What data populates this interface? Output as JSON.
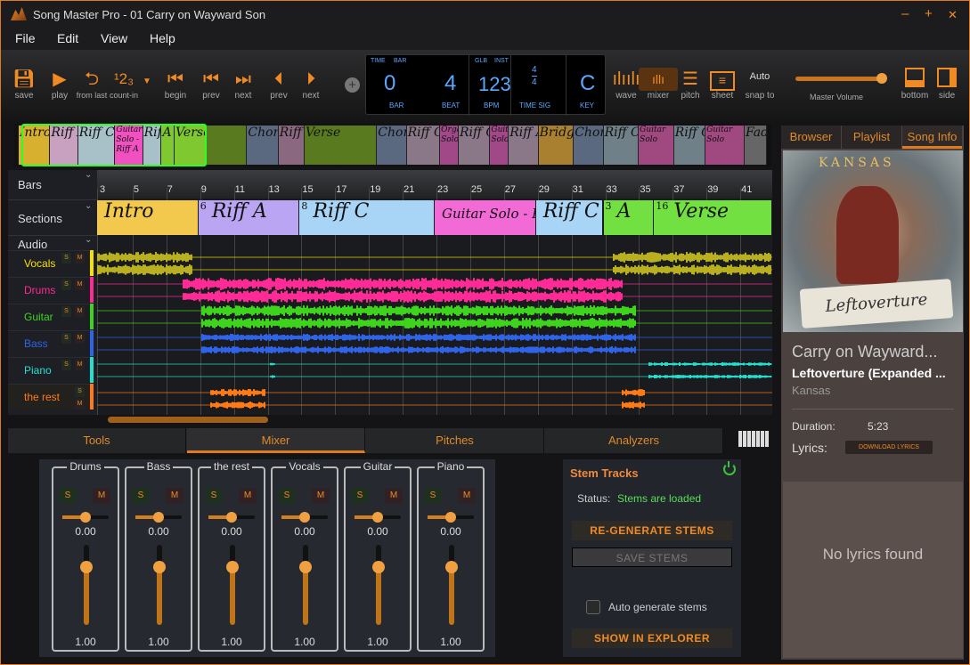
{
  "window": {
    "title": "Song Master Pro - 01 Carry on Wayward Son",
    "minimize": "–",
    "maximize": "+",
    "close": "✕"
  },
  "menu": [
    "File",
    "Edit",
    "View",
    "Help"
  ],
  "toolbar": {
    "save": "save",
    "play": "play",
    "from_last": "from last",
    "count_in": "count-in",
    "begin": "begin",
    "prev1": "prev",
    "next1": "next",
    "prev2": "prev",
    "next2": "next",
    "wave": "wave",
    "mixer": "mixer",
    "pitch": "pitch",
    "sheet": "sheet",
    "snap_value": "Auto",
    "snap": "snap to",
    "master_volume": "Master Volume",
    "master_volume_level": 0.97,
    "bottom": "bottom",
    "side": "side"
  },
  "display": {
    "time_label": "TIME",
    "bar_label_top": "BAR",
    "bar": "0",
    "bar_label": "BAR",
    "beat": "4",
    "beat_label": "BEAT",
    "glb": "GLB",
    "inst": "INST",
    "bpm": "123",
    "bpm_label": "BPM",
    "ts_num": "4",
    "ts_den": "4",
    "ts_label": "TIME SIG",
    "key": "C",
    "key_label": "KEY"
  },
  "overview": [
    {
      "label": "Intro",
      "color": "#d8b030"
    },
    {
      "label": "Riff A",
      "color": "#c8a0c0"
    },
    {
      "label": "Riff C",
      "color": "#a8c0c8"
    },
    {
      "label": "Guitar Solo - Riff A",
      "color": "#f050c0"
    },
    {
      "label": "Riff C",
      "color": "#a8c0c8"
    },
    {
      "label": "A",
      "color": "#80c830"
    },
    {
      "label": "Verse",
      "color": "#80c830"
    },
    {
      "label": "",
      "color": "#5a7a20"
    },
    {
      "label": "Chorus",
      "color": "#5a6880"
    },
    {
      "label": "Riff A",
      "color": "#8a6880"
    },
    {
      "label": "Verse",
      "color": "#5a7a20"
    },
    {
      "label": "Chorus",
      "color": "#5a6880"
    },
    {
      "label": "Riff C",
      "color": "#8a7888"
    },
    {
      "label": "Organ Solo",
      "color": "#a04888"
    },
    {
      "label": "Riff C",
      "color": "#8a7888"
    },
    {
      "label": "Guitar Solo",
      "color": "#a04888"
    },
    {
      "label": "Riff A",
      "color": "#8a7888"
    },
    {
      "label": "Bridge",
      "color": "#a88030"
    },
    {
      "label": "Chorus",
      "color": "#5a6880"
    },
    {
      "label": "Riff C",
      "color": "#708088"
    },
    {
      "label": "Guitar Solo",
      "color": "#a04880"
    },
    {
      "label": "Riff C",
      "color": "#708088"
    },
    {
      "label": "Guitar Solo",
      "color": "#a04880"
    },
    {
      "label": "Fade out",
      "color": "#666"
    }
  ],
  "lanes": {
    "bars": "Bars",
    "sections": "Sections",
    "audio": "Audio"
  },
  "bar_numbers": [
    "3",
    "5",
    "7",
    "9",
    "11",
    "13",
    "15",
    "17",
    "19",
    "21",
    "23",
    "25",
    "27",
    "29",
    "31",
    "33",
    "35",
    "37",
    "39",
    "41"
  ],
  "sections": [
    {
      "num": "",
      "label": "Intro",
      "start": 3,
      "end": 9,
      "color": "#f2c94c"
    },
    {
      "num": "6",
      "label": "Riff A",
      "start": 9,
      "end": 15,
      "color": "#b9a5f2"
    },
    {
      "num": "8",
      "label": "Riff C",
      "start": 15,
      "end": 23,
      "color": "#a8d4f5"
    },
    {
      "num": "",
      "label": "Guitar Solo - Riff A",
      "start": 23,
      "end": 29,
      "color": "#f26ad6"
    },
    {
      "num": "",
      "label": "Riff C",
      "start": 29,
      "end": 33,
      "color": "#a8d4f5"
    },
    {
      "num": "3",
      "label": "A",
      "start": 33,
      "end": 36,
      "color": "#72e040"
    },
    {
      "num": "16",
      "label": "Verse",
      "start": 36,
      "end": 43,
      "color": "#72e040"
    }
  ],
  "tracks": [
    {
      "name": "Vocals",
      "color": "#f5e100",
      "solo": "S",
      "mute": "M"
    },
    {
      "name": "Drums",
      "color": "#ff2a95",
      "solo": "S",
      "mute": "M"
    },
    {
      "name": "Guitar",
      "color": "#3ed41e",
      "solo": "S",
      "mute": "M"
    },
    {
      "name": "Bass",
      "color": "#2f63e8",
      "solo": "S",
      "mute": "M"
    },
    {
      "name": "Piano",
      "color": "#22e0cf",
      "solo": "S",
      "mute": "M"
    },
    {
      "name": "the rest",
      "color": "#ff7a14",
      "solo": "S",
      "mute": "M"
    }
  ],
  "bottom_tabs": [
    "Tools",
    "Mixer",
    "Pitches",
    "Analyzers"
  ],
  "mixer": {
    "channels": [
      {
        "name": "Drums",
        "pan": "0.00",
        "volume": "1.00"
      },
      {
        "name": "Bass",
        "pan": "0.00",
        "volume": "1.00"
      },
      {
        "name": "the rest",
        "pan": "0.00",
        "volume": "1.00"
      },
      {
        "name": "Vocals",
        "pan": "0.00",
        "volume": "1.00"
      },
      {
        "name": "Guitar",
        "pan": "0.00",
        "volume": "1.00"
      },
      {
        "name": "Piano",
        "pan": "0.00",
        "volume": "1.00"
      }
    ],
    "solo": "S",
    "mute": "M"
  },
  "stems": {
    "title": "Stem Tracks",
    "status_label": "Status:",
    "status": "Stems are loaded",
    "regenerate": "RE-GENERATE STEMS",
    "save": "SAVE STEMS",
    "auto_generate": "Auto generate stems",
    "auto_generate_checked": false,
    "show_in_explorer": "SHOW IN EXPLORER"
  },
  "right": {
    "tabs": [
      "Browser",
      "Playlist",
      "Song Info"
    ],
    "active_tab": "Song Info",
    "album_art": {
      "logo": "KANSAS",
      "title": "Leftoverture"
    },
    "song_title": "Carry on Wayward...",
    "album": "Leftoverture (Expanded ...",
    "artist": "Kansas",
    "duration_label": "Duration:",
    "duration": "5:23",
    "lyrics_label": "Lyrics:",
    "download_lyrics": "DOWNLOAD LYRICS",
    "no_lyrics": "No lyrics found"
  }
}
